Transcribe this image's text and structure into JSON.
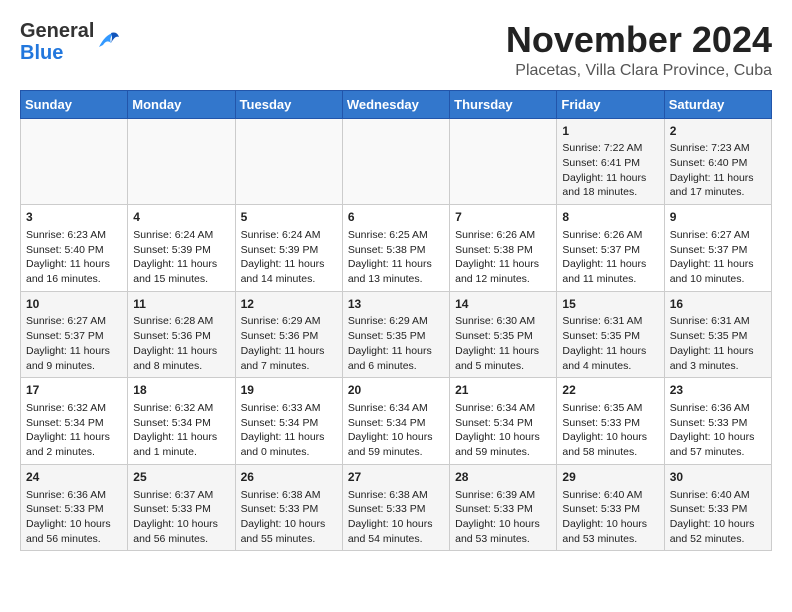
{
  "header": {
    "logo_general": "General",
    "logo_blue": "Blue",
    "month_title": "November 2024",
    "location": "Placetas, Villa Clara Province, Cuba"
  },
  "days_of_week": [
    "Sunday",
    "Monday",
    "Tuesday",
    "Wednesday",
    "Thursday",
    "Friday",
    "Saturday"
  ],
  "weeks": [
    [
      {
        "day": "",
        "content": ""
      },
      {
        "day": "",
        "content": ""
      },
      {
        "day": "",
        "content": ""
      },
      {
        "day": "",
        "content": ""
      },
      {
        "day": "",
        "content": ""
      },
      {
        "day": "1",
        "content": "Sunrise: 7:22 AM\nSunset: 6:41 PM\nDaylight: 11 hours and 18 minutes."
      },
      {
        "day": "2",
        "content": "Sunrise: 7:23 AM\nSunset: 6:40 PM\nDaylight: 11 hours and 17 minutes."
      }
    ],
    [
      {
        "day": "3",
        "content": "Sunrise: 6:23 AM\nSunset: 5:40 PM\nDaylight: 11 hours and 16 minutes."
      },
      {
        "day": "4",
        "content": "Sunrise: 6:24 AM\nSunset: 5:39 PM\nDaylight: 11 hours and 15 minutes."
      },
      {
        "day": "5",
        "content": "Sunrise: 6:24 AM\nSunset: 5:39 PM\nDaylight: 11 hours and 14 minutes."
      },
      {
        "day": "6",
        "content": "Sunrise: 6:25 AM\nSunset: 5:38 PM\nDaylight: 11 hours and 13 minutes."
      },
      {
        "day": "7",
        "content": "Sunrise: 6:26 AM\nSunset: 5:38 PM\nDaylight: 11 hours and 12 minutes."
      },
      {
        "day": "8",
        "content": "Sunrise: 6:26 AM\nSunset: 5:37 PM\nDaylight: 11 hours and 11 minutes."
      },
      {
        "day": "9",
        "content": "Sunrise: 6:27 AM\nSunset: 5:37 PM\nDaylight: 11 hours and 10 minutes."
      }
    ],
    [
      {
        "day": "10",
        "content": "Sunrise: 6:27 AM\nSunset: 5:37 PM\nDaylight: 11 hours and 9 minutes."
      },
      {
        "day": "11",
        "content": "Sunrise: 6:28 AM\nSunset: 5:36 PM\nDaylight: 11 hours and 8 minutes."
      },
      {
        "day": "12",
        "content": "Sunrise: 6:29 AM\nSunset: 5:36 PM\nDaylight: 11 hours and 7 minutes."
      },
      {
        "day": "13",
        "content": "Sunrise: 6:29 AM\nSunset: 5:35 PM\nDaylight: 11 hours and 6 minutes."
      },
      {
        "day": "14",
        "content": "Sunrise: 6:30 AM\nSunset: 5:35 PM\nDaylight: 11 hours and 5 minutes."
      },
      {
        "day": "15",
        "content": "Sunrise: 6:31 AM\nSunset: 5:35 PM\nDaylight: 11 hours and 4 minutes."
      },
      {
        "day": "16",
        "content": "Sunrise: 6:31 AM\nSunset: 5:35 PM\nDaylight: 11 hours and 3 minutes."
      }
    ],
    [
      {
        "day": "17",
        "content": "Sunrise: 6:32 AM\nSunset: 5:34 PM\nDaylight: 11 hours and 2 minutes."
      },
      {
        "day": "18",
        "content": "Sunrise: 6:32 AM\nSunset: 5:34 PM\nDaylight: 11 hours and 1 minute."
      },
      {
        "day": "19",
        "content": "Sunrise: 6:33 AM\nSunset: 5:34 PM\nDaylight: 11 hours and 0 minutes."
      },
      {
        "day": "20",
        "content": "Sunrise: 6:34 AM\nSunset: 5:34 PM\nDaylight: 10 hours and 59 minutes."
      },
      {
        "day": "21",
        "content": "Sunrise: 6:34 AM\nSunset: 5:34 PM\nDaylight: 10 hours and 59 minutes."
      },
      {
        "day": "22",
        "content": "Sunrise: 6:35 AM\nSunset: 5:33 PM\nDaylight: 10 hours and 58 minutes."
      },
      {
        "day": "23",
        "content": "Sunrise: 6:36 AM\nSunset: 5:33 PM\nDaylight: 10 hours and 57 minutes."
      }
    ],
    [
      {
        "day": "24",
        "content": "Sunrise: 6:36 AM\nSunset: 5:33 PM\nDaylight: 10 hours and 56 minutes."
      },
      {
        "day": "25",
        "content": "Sunrise: 6:37 AM\nSunset: 5:33 PM\nDaylight: 10 hours and 56 minutes."
      },
      {
        "day": "26",
        "content": "Sunrise: 6:38 AM\nSunset: 5:33 PM\nDaylight: 10 hours and 55 minutes."
      },
      {
        "day": "27",
        "content": "Sunrise: 6:38 AM\nSunset: 5:33 PM\nDaylight: 10 hours and 54 minutes."
      },
      {
        "day": "28",
        "content": "Sunrise: 6:39 AM\nSunset: 5:33 PM\nDaylight: 10 hours and 53 minutes."
      },
      {
        "day": "29",
        "content": "Sunrise: 6:40 AM\nSunset: 5:33 PM\nDaylight: 10 hours and 53 minutes."
      },
      {
        "day": "30",
        "content": "Sunrise: 6:40 AM\nSunset: 5:33 PM\nDaylight: 10 hours and 52 minutes."
      }
    ]
  ]
}
